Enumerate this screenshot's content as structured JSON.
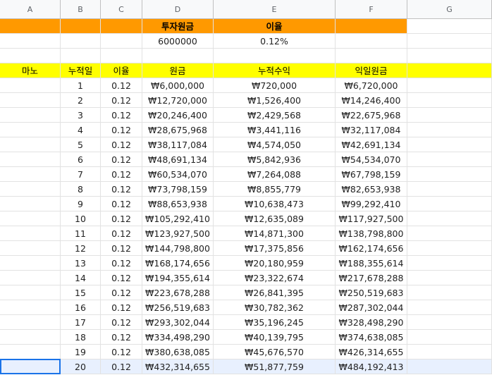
{
  "columns": [
    "A",
    "B",
    "C",
    "D",
    "E",
    "F",
    "G"
  ],
  "title_row": {
    "d": "투자원금",
    "e": "이율"
  },
  "value_row": {
    "d": "6000000",
    "e": "0.12%"
  },
  "header_row": {
    "a": "마노",
    "b": "누적일",
    "c": "이율",
    "d": "원금",
    "e": "누적수익",
    "f": "익일원금"
  },
  "rows": [
    {
      "day": "1",
      "rate": "0.12",
      "principal": "₩6,000,000",
      "accum": "₩720,000",
      "next": "₩6,720,000"
    },
    {
      "day": "2",
      "rate": "0.12",
      "principal": "₩12,720,000",
      "accum": "₩1,526,400",
      "next": "₩14,246,400"
    },
    {
      "day": "3",
      "rate": "0.12",
      "principal": "₩20,246,400",
      "accum": "₩2,429,568",
      "next": "₩22,675,968"
    },
    {
      "day": "4",
      "rate": "0.12",
      "principal": "₩28,675,968",
      "accum": "₩3,441,116",
      "next": "₩32,117,084"
    },
    {
      "day": "5",
      "rate": "0.12",
      "principal": "₩38,117,084",
      "accum": "₩4,574,050",
      "next": "₩42,691,134"
    },
    {
      "day": "6",
      "rate": "0.12",
      "principal": "₩48,691,134",
      "accum": "₩5,842,936",
      "next": "₩54,534,070"
    },
    {
      "day": "7",
      "rate": "0.12",
      "principal": "₩60,534,070",
      "accum": "₩7,264,088",
      "next": "₩67,798,159"
    },
    {
      "day": "8",
      "rate": "0.12",
      "principal": "₩73,798,159",
      "accum": "₩8,855,779",
      "next": "₩82,653,938"
    },
    {
      "day": "9",
      "rate": "0.12",
      "principal": "₩88,653,938",
      "accum": "₩10,638,473",
      "next": "₩99,292,410"
    },
    {
      "day": "10",
      "rate": "0.12",
      "principal": "₩105,292,410",
      "accum": "₩12,635,089",
      "next": "₩117,927,500"
    },
    {
      "day": "11",
      "rate": "0.12",
      "principal": "₩123,927,500",
      "accum": "₩14,871,300",
      "next": "₩138,798,800"
    },
    {
      "day": "12",
      "rate": "0.12",
      "principal": "₩144,798,800",
      "accum": "₩17,375,856",
      "next": "₩162,174,656"
    },
    {
      "day": "13",
      "rate": "0.12",
      "principal": "₩168,174,656",
      "accum": "₩20,180,959",
      "next": "₩188,355,614"
    },
    {
      "day": "14",
      "rate": "0.12",
      "principal": "₩194,355,614",
      "accum": "₩23,322,674",
      "next": "₩217,678,288"
    },
    {
      "day": "15",
      "rate": "0.12",
      "principal": "₩223,678,288",
      "accum": "₩26,841,395",
      "next": "₩250,519,683"
    },
    {
      "day": "16",
      "rate": "0.12",
      "principal": "₩256,519,683",
      "accum": "₩30,782,362",
      "next": "₩287,302,044"
    },
    {
      "day": "17",
      "rate": "0.12",
      "principal": "₩293,302,044",
      "accum": "₩35,196,245",
      "next": "₩328,498,290"
    },
    {
      "day": "18",
      "rate": "0.12",
      "principal": "₩334,498,290",
      "accum": "₩40,139,795",
      "next": "₩374,638,085"
    },
    {
      "day": "19",
      "rate": "0.12",
      "principal": "₩380,638,085",
      "accum": "₩45,676,570",
      "next": "₩426,314,655"
    },
    {
      "day": "20",
      "rate": "0.12",
      "principal": "₩432,314,655",
      "accum": "₩51,877,759",
      "next": "₩484,192,413"
    }
  ],
  "selected_row": 20,
  "colors": {
    "title_bg": "#ff9900",
    "header_bg": "#ffff00",
    "selection": "#1a73e8"
  }
}
